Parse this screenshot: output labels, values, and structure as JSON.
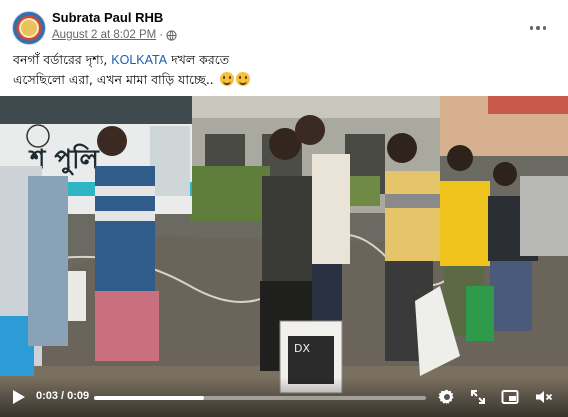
{
  "post": {
    "author": "Subrata Paul RHB",
    "date": "August 2 at 8:02 PM",
    "dot": "·",
    "caption_line1_prefix": "বনগাঁ বর্ডারের দৃশ্য, ",
    "caption_tag": "KOLKATA",
    "caption_line1_suffix": " দখল করতে",
    "caption_line2": "এসেছিলো এরা, এখন মামা বাড়ি যাচ্ছে.. "
  },
  "video": {
    "current_time": "0:03",
    "separator": "/",
    "duration": "0:09",
    "progress": 0.33,
    "bus_text": "শ পুলি",
    "bag_text": "DX",
    "icons": [
      "play-icon",
      "settings-gear-icon",
      "fullscreen-expand-icon",
      "picture-in-picture-icon",
      "volume-mute-icon"
    ]
  },
  "colors": {
    "link_tag": "#1a5fb4",
    "meta_text": "#65676b"
  }
}
